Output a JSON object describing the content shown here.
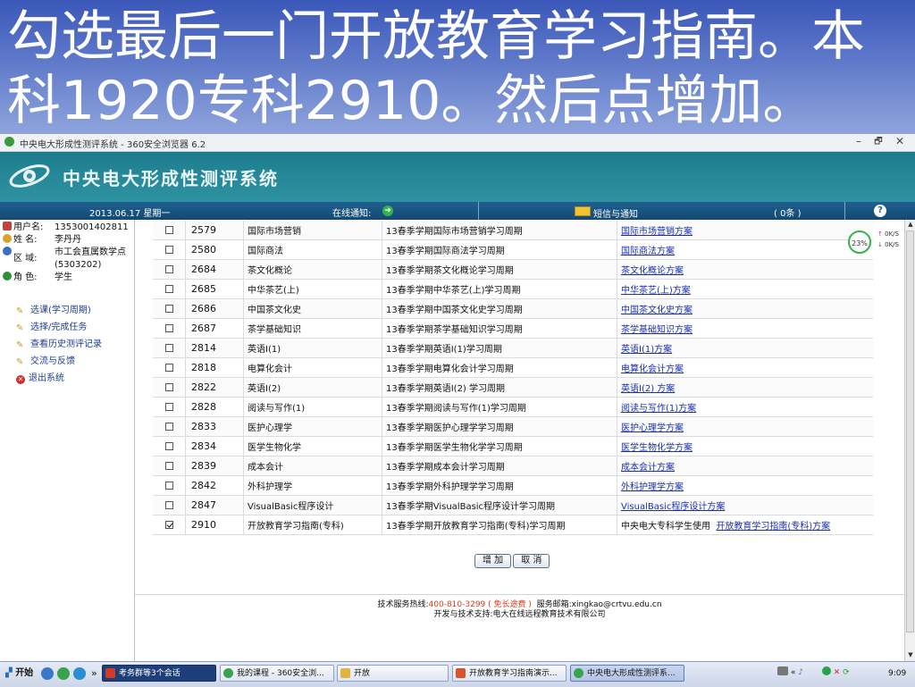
{
  "slide": {
    "title_line1": "勾选最后一门开放教育学习指南。本",
    "title_line2": "科1920专科2910。然后点增加。"
  },
  "browser": {
    "title": "中央电大形成性测评系统 - 360安全浏览器 6.2",
    "min": "–",
    "max": "🗗",
    "close": "✕"
  },
  "app": {
    "system_name": "中央电大形成性测评系统",
    "date": "2013.06.17 星期一",
    "online_notice": "在线通知:",
    "sms_label": "短信与通知",
    "sms_count": "( 0条 )",
    "help": "?"
  },
  "user": {
    "username_label": "用户名:",
    "username": "1353001402811",
    "name_label": "姓   名:",
    "name": "李丹丹",
    "region_label": "区   域:",
    "region": "市工会直属数学点(5303202)",
    "role_label": "角   色:",
    "role": "学生"
  },
  "menu": [
    {
      "label": "选课(学习周期)"
    },
    {
      "label": "选择/完成任务"
    },
    {
      "label": "查看历史测评记录"
    },
    {
      "label": "交流与反馈"
    },
    {
      "label": "退出系统"
    }
  ],
  "courses": [
    {
      "checked": false,
      "code": "2579",
      "name": "国际市场营销",
      "period": "13春季学期国际市场营销学习周期",
      "prefix": "",
      "plan": "国际市场营销方案"
    },
    {
      "checked": false,
      "code": "2580",
      "name": "国际商法",
      "period": "13春季学期国际商法学习周期",
      "prefix": "",
      "plan": "国际商法方案"
    },
    {
      "checked": false,
      "code": "2684",
      "name": "茶文化概论",
      "period": "13春季学期茶文化概论学习周期",
      "prefix": "",
      "plan": "茶文化概论方案"
    },
    {
      "checked": false,
      "code": "2685",
      "name": "中华茶艺(上)",
      "period": "13春季学期中华茶艺(上)学习周期",
      "prefix": "",
      "plan": "中华茶艺(上)方案"
    },
    {
      "checked": false,
      "code": "2686",
      "name": "中国茶文化史",
      "period": "13春季学期中国茶文化史学习周期",
      "prefix": "",
      "plan": "中国茶文化史方案"
    },
    {
      "checked": false,
      "code": "2687",
      "name": "茶学基础知识",
      "period": "13春季学期茶学基础知识学习周期",
      "prefix": "",
      "plan": "茶学基础知识方案"
    },
    {
      "checked": false,
      "code": "2814",
      "name": "英语I(1)",
      "period": "13春季学期英语I(1)学习周期",
      "prefix": "",
      "plan": "英语I(1)方案"
    },
    {
      "checked": false,
      "code": "2818",
      "name": "电算化会计",
      "period": "13春季学期电算化会计学习周期",
      "prefix": "",
      "plan": "电算化会计方案"
    },
    {
      "checked": false,
      "code": "2822",
      "name": "英语I(2)",
      "period": "13春季学期英语I(2) 学习周期",
      "prefix": "",
      "plan": "英语I(2) 方案"
    },
    {
      "checked": false,
      "code": "2828",
      "name": "阅读与写作(1)",
      "period": "13春季学期阅读与写作(1)学习周期",
      "prefix": "",
      "plan": "阅读与写作(1)方案"
    },
    {
      "checked": false,
      "code": "2833",
      "name": "医护心理学",
      "period": "13春季学期医护心理学学习周期",
      "prefix": "",
      "plan": "医护心理学方案"
    },
    {
      "checked": false,
      "code": "2834",
      "name": "医学生物化学",
      "period": "13春季学期医学生物化学学习周期",
      "prefix": "",
      "plan": "医学生物化学方案"
    },
    {
      "checked": false,
      "code": "2839",
      "name": "成本会计",
      "period": "13春季学期成本会计学习周期",
      "prefix": "",
      "plan": "成本会计方案"
    },
    {
      "checked": false,
      "code": "2842",
      "name": "外科护理学",
      "period": "13春季学期外科护理学学习周期",
      "prefix": "",
      "plan": "外科护理学方案"
    },
    {
      "checked": false,
      "code": "2847",
      "name": "VisualBasic程序设计",
      "period": "13春季学期VisualBasic程序设计学习周期",
      "prefix": "",
      "plan": "VisualBasic程序设计方案"
    },
    {
      "checked": true,
      "code": "2910",
      "name": "开放教育学习指南(专科)",
      "period": "13春季学期开放教育学习指南(专科)学习周期",
      "prefix": "中央电大专科学生使用",
      "plan": "开放教育学习指南(专科)方案"
    }
  ],
  "buttons": {
    "add": "增 加",
    "cancel": "取 消"
  },
  "footer": {
    "hotline_label": "技术服务热线:",
    "hotline": "400-810-3299 ( 免长途费 )",
    "email_label": "服务邮箱:",
    "email": "xingkao@crtvu.edu.cn",
    "support": "开发与技术支持:电大在线远程教育技术有限公司"
  },
  "speed": {
    "percent": "23%",
    "up": "0K/S",
    "down": "0K/S"
  },
  "taskbar": {
    "start": "开始",
    "chevron": "»",
    "items": [
      {
        "label": "考务群等3个会话"
      },
      {
        "label": "我的课程 - 360安全浏..."
      },
      {
        "label": "开放"
      },
      {
        "label": "开放教育学习指南演示..."
      },
      {
        "label": "中央电大形成性测评系..."
      }
    ],
    "tray": "« ",
    "clock": "9:09"
  },
  "colors": {
    "slide_bg": "#4a66c0",
    "banner": "#1c7c8d",
    "navbar": "#1f5f8f",
    "link": "#1a2fb0"
  }
}
